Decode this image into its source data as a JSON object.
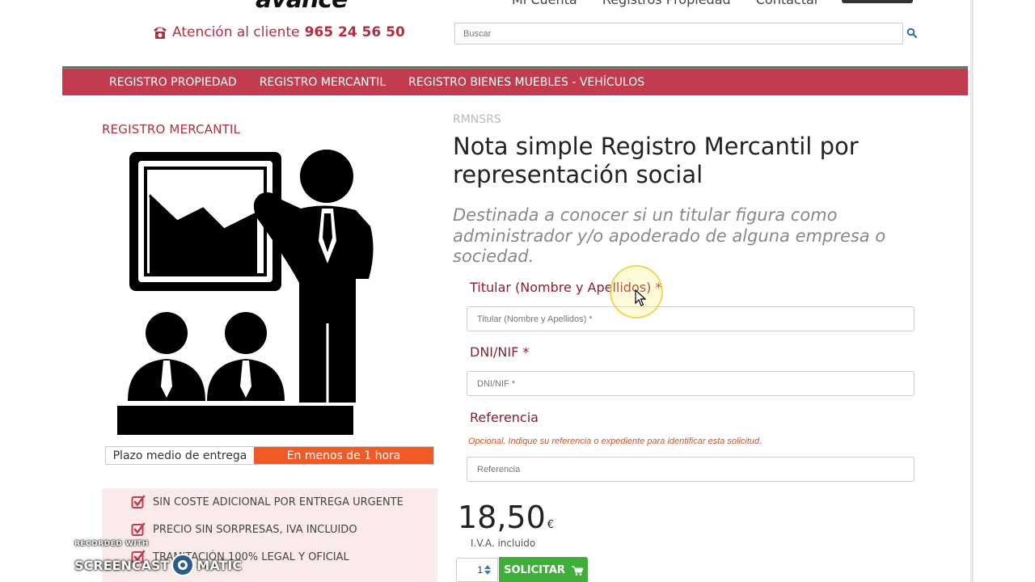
{
  "header": {
    "logo_text": "avance",
    "top_links": [
      "Mi Cuenta",
      "Registros Propiedad",
      "Contactar"
    ],
    "phone_label": "Atención al cliente",
    "phone_number": "965 24 56 50",
    "search_placeholder": "Buscar"
  },
  "nav": {
    "items": [
      "REGISTRO PROPIEDAD",
      "REGISTRO MERCANTIL",
      "REGISTRO BIENES MUEBLES - VEHÍCULOS"
    ]
  },
  "left": {
    "category_title": "REGISTRO MERCANTIL",
    "delivery_label": "Plazo medio de entrega",
    "delivery_value": "En menos de 1 hora",
    "features": [
      "SIN COSTE ADICIONAL POR ENTREGA URGENTE",
      "PRECIO SIN SORPRESAS, IVA INCLUIDO",
      "TRAMITACIÓN 100% LEGAL Y OFICIAL"
    ]
  },
  "product": {
    "sku": "RMNSRS",
    "title": "Nota simple Registro Mercantil por representación social",
    "description": "Destinada a conocer si un titular figura como administrador y/o apoderado de alguna empresa o sociedad.",
    "fields": {
      "titular_label": "Titular (Nombre y Apellidos) *",
      "titular_placeholder": "Titular (Nombre y Apellidos) *",
      "dni_label": "DNI/NIF *",
      "dni_placeholder": "DNI/NIF *",
      "ref_label": "Referencia",
      "ref_hint": "Opcional. Indique su referencia o expediente para identificar esta solicitud.",
      "ref_placeholder": "Referencia"
    },
    "price": "18,50",
    "currency": "€",
    "tax_note": "I.V.A. incluido",
    "quantity": "1",
    "buy_label": "SOLICITAR"
  },
  "watermark": {
    "recorded": "RECORDED WITH",
    "brand_left": "SCREENCAST",
    "brand_right": "MATIC"
  },
  "colors": {
    "brand_red": "#c23b4f",
    "accent_orange": "#f15a24",
    "buy_green": "#3fae3a"
  }
}
